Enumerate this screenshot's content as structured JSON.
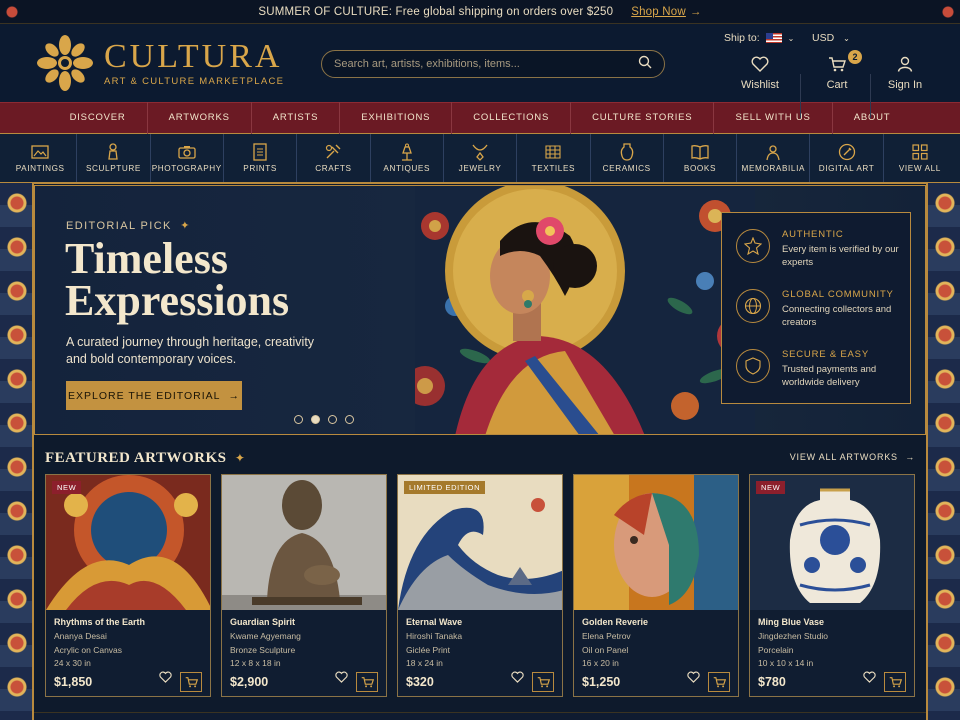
{
  "announcement": {
    "text": "SUMMER OF CULTURE: Free global shipping on orders over $250",
    "link": "Shop Now"
  },
  "brand": {
    "name": "CULTURA",
    "tagline": "ART & CULTURE MARKETPLACE"
  },
  "search": {
    "placeholder": "Search art, artists, exhibitions, items..."
  },
  "locale": {
    "ship_to_label": "Ship to:",
    "currency": "USD"
  },
  "header_actions": {
    "wishlist": "Wishlist",
    "cart": "Cart",
    "cart_count": "2",
    "signin": "Sign In"
  },
  "main_nav": [
    "DISCOVER",
    "ARTWORKS",
    "ARTISTS",
    "EXHIBITIONS",
    "COLLECTIONS",
    "CULTURE STORIES",
    "SELL WITH US",
    "ABOUT"
  ],
  "categories": [
    {
      "label": "PAINTINGS",
      "icon": "painting-icon"
    },
    {
      "label": "SCULPTURE",
      "icon": "sculpture-icon"
    },
    {
      "label": "PHOTOGRAPHY",
      "icon": "camera-icon"
    },
    {
      "label": "PRINTS",
      "icon": "print-icon"
    },
    {
      "label": "CRAFTS",
      "icon": "crafts-icon"
    },
    {
      "label": "ANTIQUES",
      "icon": "antiques-icon"
    },
    {
      "label": "JEWELRY",
      "icon": "jewelry-icon"
    },
    {
      "label": "TEXTILES",
      "icon": "textiles-icon"
    },
    {
      "label": "CERAMICS",
      "icon": "ceramics-icon"
    },
    {
      "label": "BOOKS",
      "icon": "book-icon"
    },
    {
      "label": "MEMORABILIA",
      "icon": "memorabilia-icon"
    },
    {
      "label": "DIGITAL ART",
      "icon": "digital-art-icon"
    },
    {
      "label": "VIEW ALL",
      "icon": "grid-icon"
    }
  ],
  "hero": {
    "eyebrow": "EDITORIAL PICK",
    "title_line1": "Timeless",
    "title_line2": "Expressions",
    "description": "A curated journey through heritage, creativity and bold contemporary voices.",
    "cta": "EXPLORE THE EDITORIAL",
    "slides": 4,
    "active_slide": 2
  },
  "features": [
    {
      "title": "AUTHENTIC",
      "desc": "Every item is verified by our experts",
      "icon": "badge-icon"
    },
    {
      "title": "GLOBAL COMMUNITY",
      "desc": "Connecting collectors and creators",
      "icon": "globe-icon"
    },
    {
      "title": "SECURE & EASY",
      "desc": "Trusted payments and worldwide delivery",
      "icon": "shield-icon"
    }
  ],
  "featured": {
    "title": "FEATURED ARTWORKS",
    "view_all": "VIEW ALL ARTWORKS",
    "items": [
      {
        "title": "Rhythms of the Earth",
        "artist": "Ananya Desai",
        "medium": "Acrylic on Canvas",
        "size": "24 x 30 in",
        "price": "$1,850",
        "tag": "NEW",
        "tag_color": "#8c1f2c"
      },
      {
        "title": "Guardian Spirit",
        "artist": "Kwame Agyemang",
        "medium": "Bronze Sculpture",
        "size": "12 x 8 x 18 in",
        "price": "$2,900",
        "tag": "",
        "tag_color": ""
      },
      {
        "title": "Eternal Wave",
        "artist": "Hiroshi Tanaka",
        "medium": "Giclée Print",
        "size": "18 x 24 in",
        "price": "$320",
        "tag": "LIMITED EDITION",
        "tag_color": "#a57a2c"
      },
      {
        "title": "Golden Reverie",
        "artist": "Elena Petrov",
        "medium": "Oil on Panel",
        "size": "16 x 20 in",
        "price": "$1,250",
        "tag": "",
        "tag_color": ""
      },
      {
        "title": "Ming Blue Vase",
        "artist": "Jingdezhen Studio",
        "medium": "Porcelain",
        "size": "10 x 10 x 14 in",
        "price": "$780",
        "tag": "NEW",
        "tag_color": "#8c1f2c"
      }
    ]
  },
  "colors": {
    "gold": "#d9a64a",
    "navy": "#0c1a30",
    "maroon": "#6b1a24",
    "cream": "#f3e7cc"
  }
}
